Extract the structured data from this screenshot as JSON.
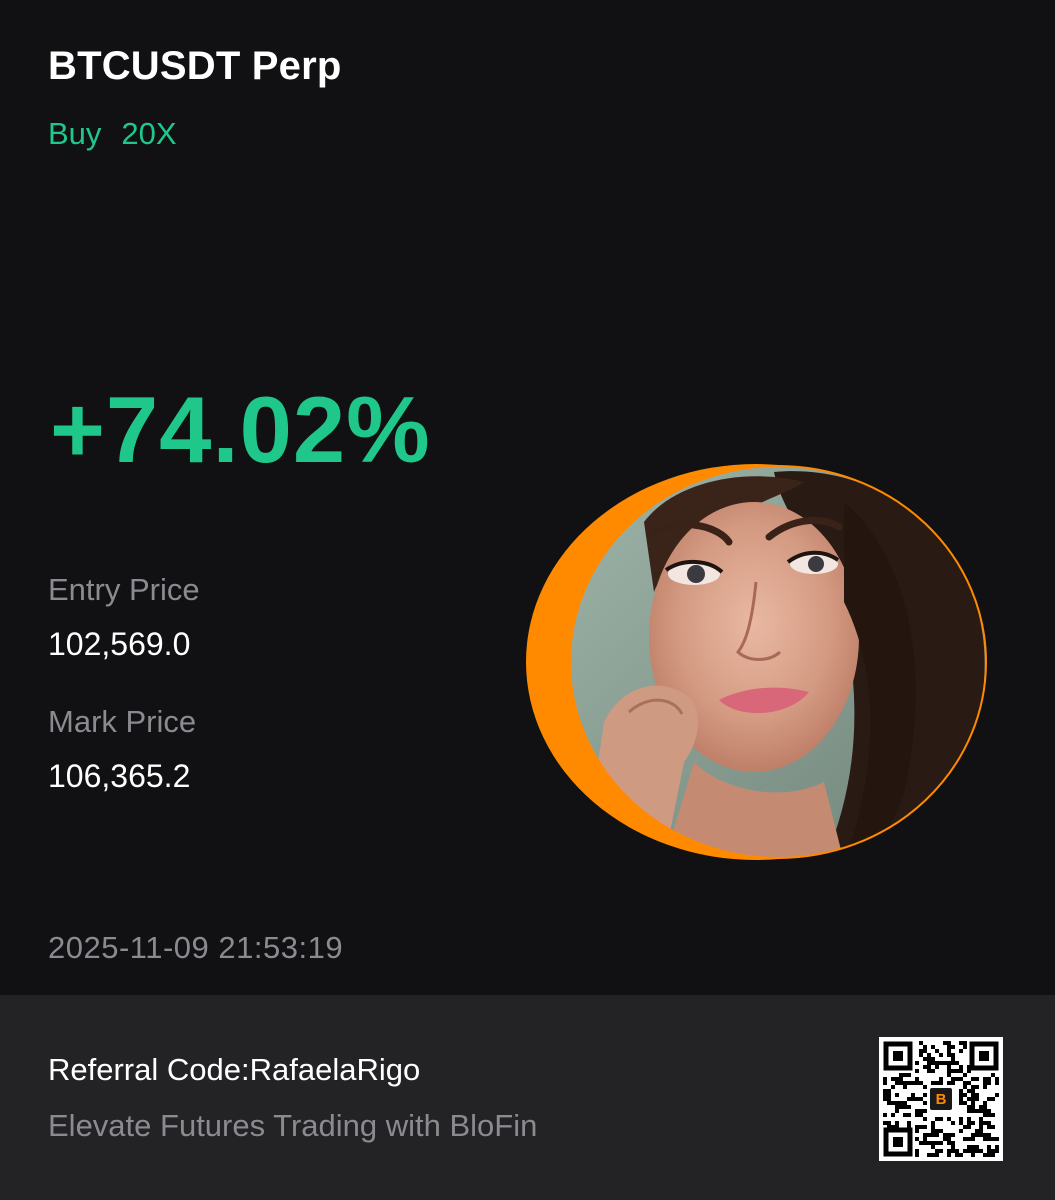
{
  "position": {
    "symbol_title": "BTCUSDT Perp",
    "side": "Buy",
    "leverage": "20X",
    "pnl_percent": "+74.02%",
    "entry_price_label": "Entry Price",
    "entry_price": "102,569.0",
    "mark_price_label": "Mark Price",
    "mark_price": "106,365.2",
    "timestamp": "2025-11-09 21:53:19"
  },
  "footer": {
    "referral_label": "Referral Code:",
    "referral_code": "RafaelaRigo",
    "tagline": "Elevate Futures Trading with BloFin"
  },
  "colors": {
    "background": "#111113",
    "footer_background": "#232325",
    "accent_green": "#1fc88a",
    "muted_text": "#8a8a90",
    "avatar_ring": "#ff8a00"
  },
  "icons": {
    "avatar": "user-avatar-photo",
    "qr": "referral-qr-code",
    "qr_logo": "blofin-logo-icon"
  }
}
